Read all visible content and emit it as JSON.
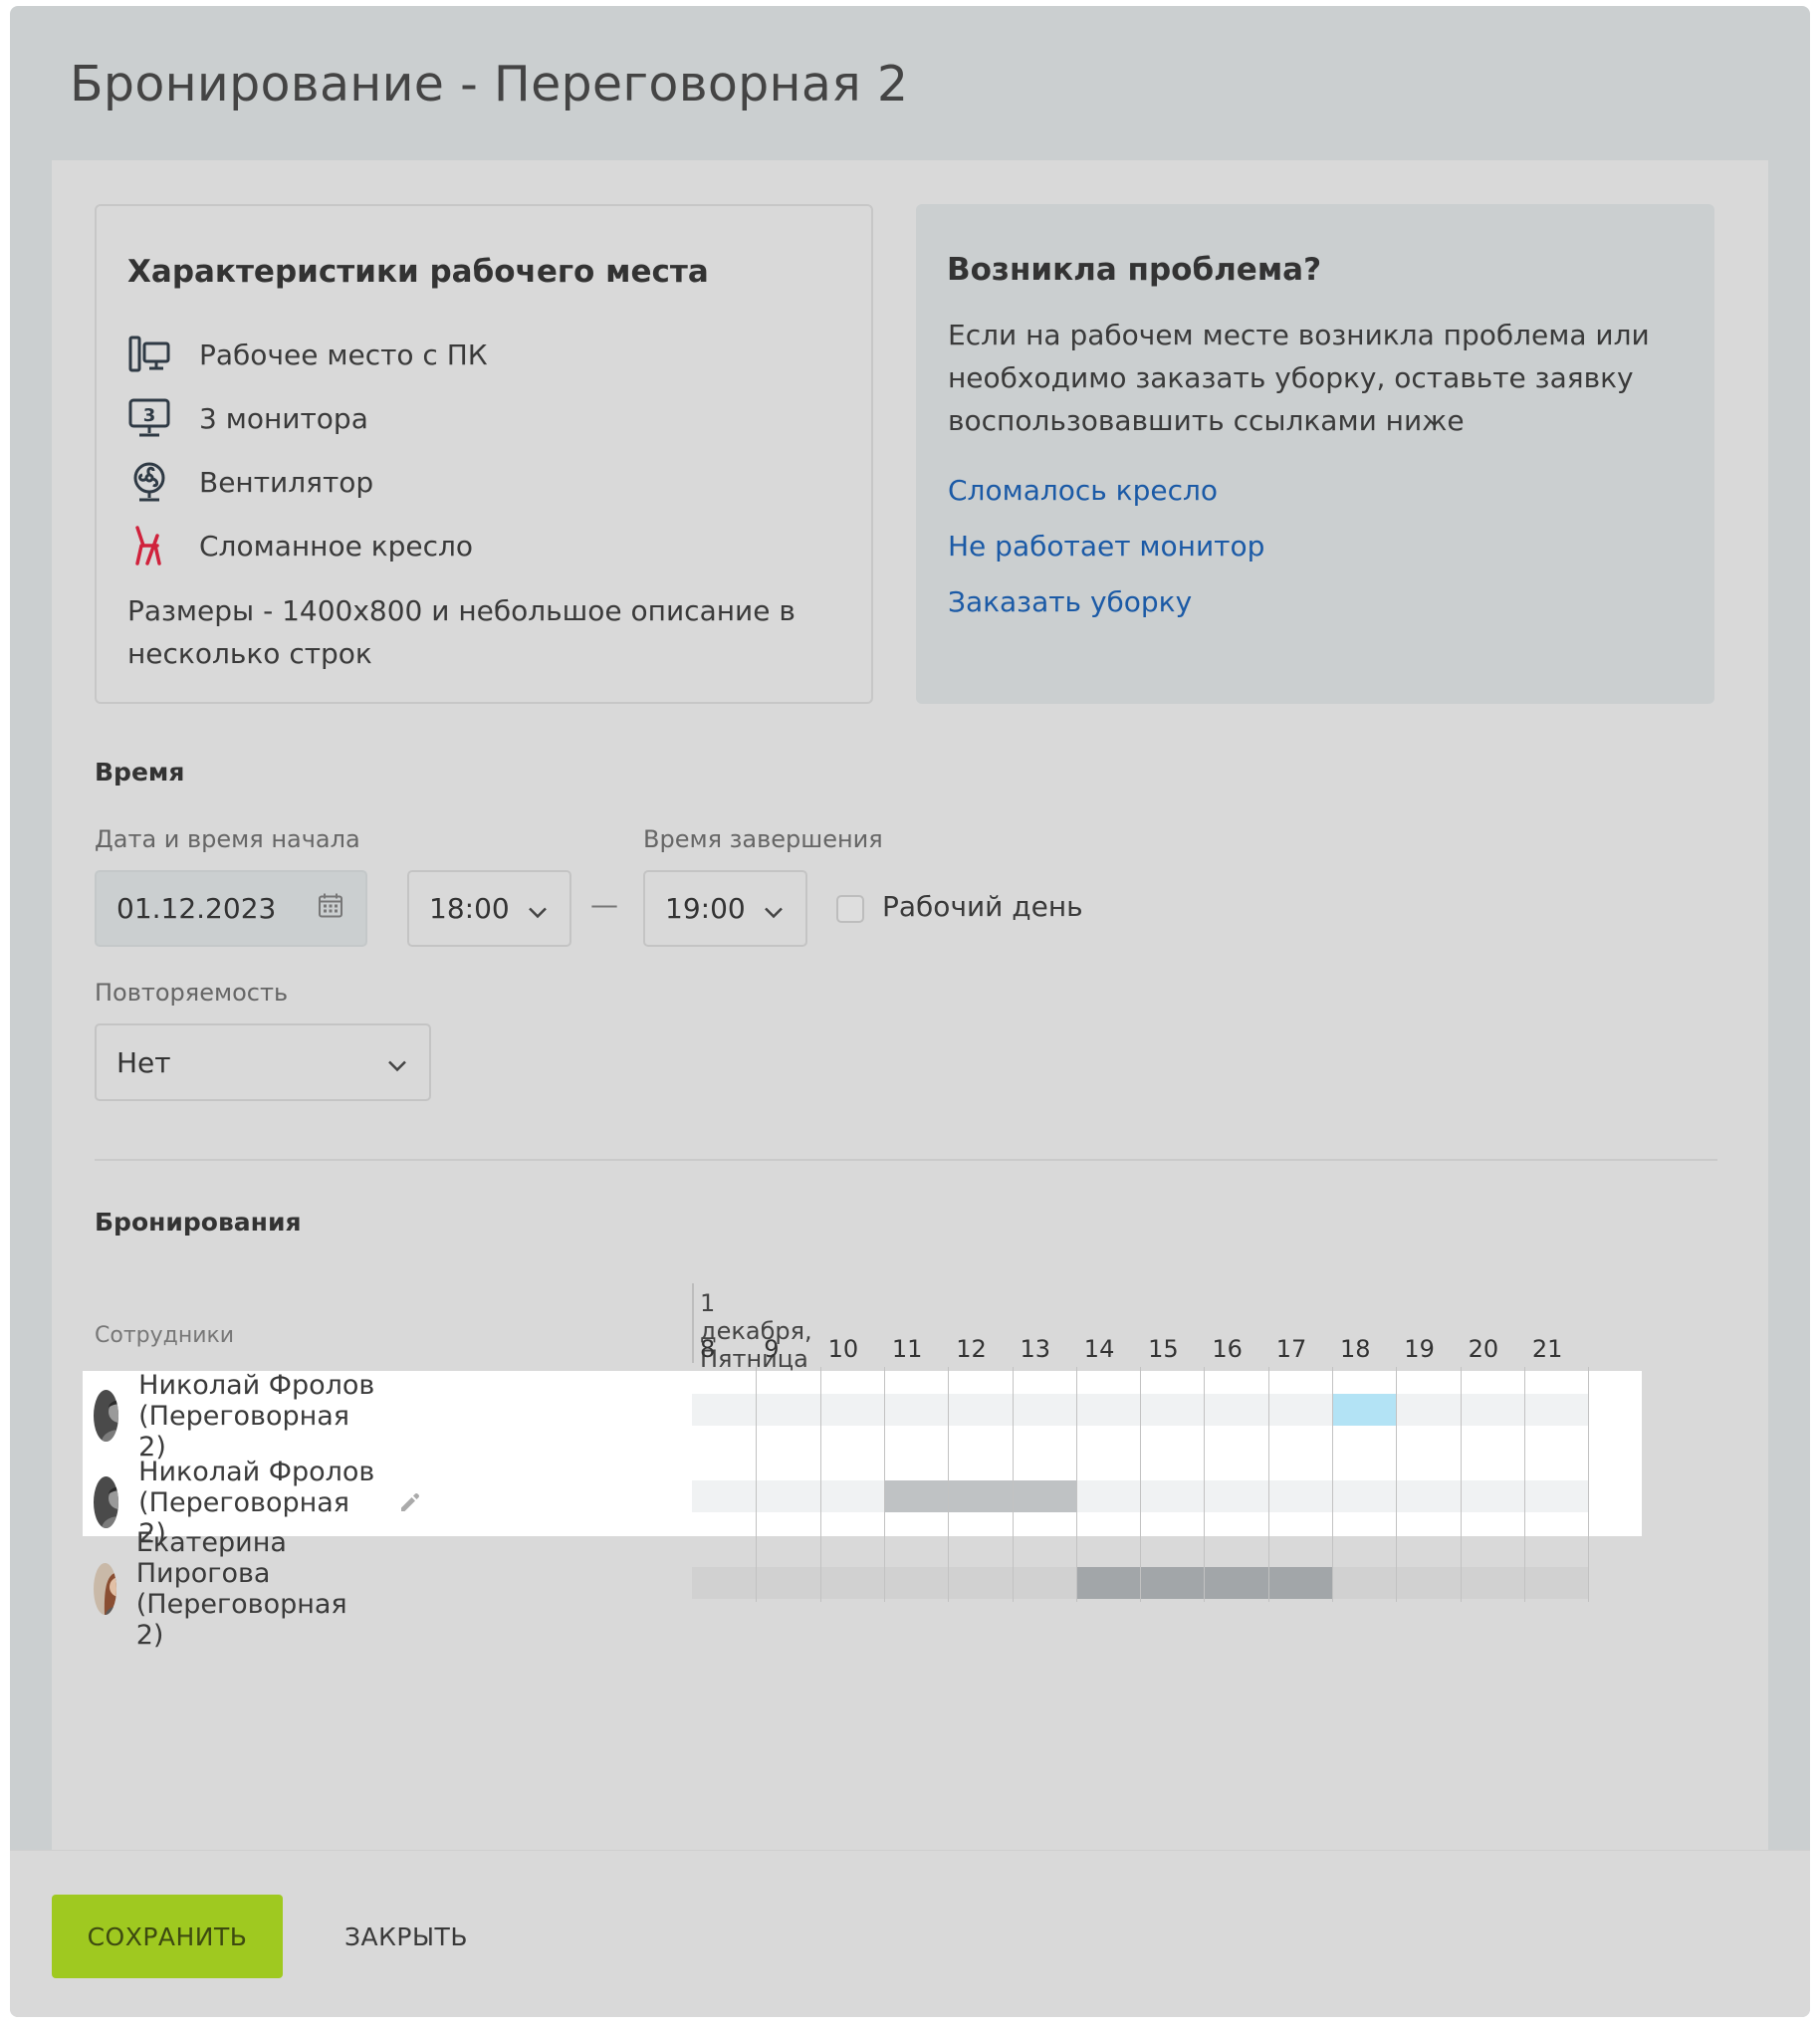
{
  "dialog": {
    "title": "Бронирование - Переговорная 2"
  },
  "workplace": {
    "heading": "Характеристики рабочего места",
    "features": [
      {
        "icon": "desktop-pc-icon",
        "label": "Рабочее место с ПК"
      },
      {
        "icon": "monitor-3-icon",
        "label": "3 монитора"
      },
      {
        "icon": "fan-icon",
        "label": "Вентилятор"
      },
      {
        "icon": "broken-chair-icon",
        "label": "Сломанное кресло"
      }
    ],
    "description": "Размеры - 1400х800 и небольшое описание в несколько строк",
    "monitor_count": "3"
  },
  "problem": {
    "heading": "Возникла проблема?",
    "text": "Если на рабочем месте возникла проблема или необходимо заказать уборку, оставьте заявку воспользовавшить ссылками ниже",
    "links": [
      "Сломалось кресло",
      "Не работает монитор",
      "Заказать уборку"
    ]
  },
  "time": {
    "section": "Время",
    "start_label": "Дата и время начала",
    "end_label": "Время завершения",
    "date_value": "01.12.2023",
    "start_time": "18:00",
    "end_time": "19:00",
    "dash": "—",
    "workday_label": "Рабочий день",
    "workday_checked": false,
    "repeat_label": "Повторяемость",
    "repeat_value": "Нет"
  },
  "bookings": {
    "section": "Бронирования",
    "employees_header": "Сотрудники",
    "day_label": "1 декабря, Пятница",
    "hours": [
      8,
      9,
      10,
      11,
      12,
      13,
      14,
      15,
      16,
      17,
      18,
      19,
      20,
      21
    ],
    "rows": [
      {
        "name": "Николай Фролов (Переговорная 2)",
        "start": 18,
        "end": 19,
        "color": "#b3e3f5",
        "highlighted": true,
        "editable": false,
        "avatar": "male"
      },
      {
        "name": "Николай Фролов (Переговорная 2)",
        "start": 11,
        "end": 14,
        "color": "#bfc2c4",
        "highlighted": true,
        "editable": true,
        "avatar": "male"
      },
      {
        "name": "Екатерина Пирогова (Переговорная 2)",
        "start": 14,
        "end": 18,
        "color": "#a2a6a9",
        "highlighted": false,
        "editable": false,
        "avatar": "female"
      }
    ]
  },
  "footer": {
    "save": "СОХРАНИТЬ",
    "close": "ЗАКРЫТЬ"
  },
  "colors": {
    "accent": "#9fc920",
    "link": "#1b5aa6",
    "broken": "#d0223c"
  }
}
